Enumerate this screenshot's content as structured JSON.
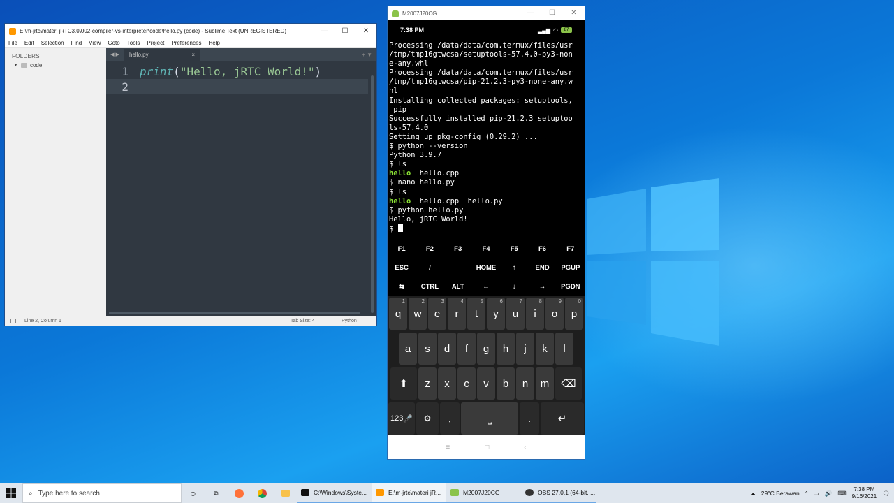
{
  "colors": {
    "sublime_bg": "#303841",
    "string": "#99c794",
    "keyword": "#5fb3b3",
    "terminal_green": "#8ae234",
    "desktop_blue": "#0b78d8"
  },
  "sublime": {
    "title": "E:\\m-jrtc\\materi jRTC3.0\\002-compiler-vs-interpreter\\code\\hello.py (code) - Sublime Text (UNREGISTERED)",
    "menu": [
      "File",
      "Edit",
      "Selection",
      "Find",
      "View",
      "Goto",
      "Tools",
      "Project",
      "Preferences",
      "Help"
    ],
    "sidebar": {
      "header": "FOLDERS",
      "folder": "code"
    },
    "tab": {
      "name": "hello.py",
      "close": "×"
    },
    "lines": [
      {
        "num": "1",
        "kw": "print",
        "open": "(",
        "str": "\"Hello, jRTC World!\"",
        "close": ")"
      },
      {
        "num": "2"
      }
    ],
    "status": {
      "position": "Line 2, Column 1",
      "tab_size": "Tab Size: 4",
      "syntax": "Python"
    }
  },
  "phone": {
    "title": "M2007J20CG",
    "time": "7:38 PM",
    "battery": "87",
    "terminal": [
      "Processing /data/data/com.termux/files/usr",
      "/tmp/tmp16gtwcsa/setuptools-57.4.0-py3-non",
      "e-any.whl",
      "Processing /data/data/com.termux/files/usr",
      "/tmp/tmp16gtwcsa/pip-21.2.3-py3-none-any.w",
      "hl",
      "Installing collected packages: setuptools,",
      " pip",
      "Successfully installed pip-21.2.3 setuptoo",
      "ls-57.4.0",
      "Setting up pkg-config (0.29.2) ...",
      "$ python --version",
      "Python 3.9.7",
      "$ ls"
    ],
    "terminal2": {
      "ls1_a": "hello",
      "ls1_b": "  hello.cpp",
      "cmd_nano": "$ nano hello.py",
      "cmd_ls": "$ ls",
      "ls2_a": "hello",
      "ls2_b": "  hello.cpp  hello.py",
      "cmd_run": "$ python hello.py",
      "output": "Hello, jRTC World!",
      "prompt": "$ "
    },
    "extra_keys": [
      [
        "F1",
        "F2",
        "F3",
        "F4",
        "F5",
        "F6",
        "F7"
      ],
      [
        "ESC",
        "/",
        "—",
        "HOME",
        "↑",
        "END",
        "PGUP"
      ],
      [
        "⇆",
        "CTRL",
        "ALT",
        "←",
        "↓",
        "→",
        "PGDN"
      ]
    ],
    "keyboard": {
      "row1": [
        [
          "q",
          "1"
        ],
        [
          "w",
          "2"
        ],
        [
          "e",
          "3"
        ],
        [
          "r",
          "4"
        ],
        [
          "t",
          "5"
        ],
        [
          "y",
          "6"
        ],
        [
          "u",
          "7"
        ],
        [
          "i",
          "8"
        ],
        [
          "o",
          "9"
        ],
        [
          "p",
          "0"
        ]
      ],
      "row2": [
        "a",
        "s",
        "d",
        "f",
        "g",
        "h",
        "j",
        "k",
        "l"
      ],
      "row3": [
        "z",
        "x",
        "c",
        "v",
        "b",
        "n",
        "m"
      ],
      "row4": {
        "numbers": "123",
        "comma": ",",
        "period": "."
      }
    }
  },
  "taskbar": {
    "search_placeholder": "Type here to search",
    "apps": [
      "C:\\Windows\\Syste...",
      "E:\\m-jrtc\\materi jR...",
      "M2007J20CG",
      "OBS 27.0.1 (64-bit, ..."
    ],
    "weather": "29°C  Berawan",
    "time": "7:38 PM",
    "date": "9/16/2021"
  }
}
